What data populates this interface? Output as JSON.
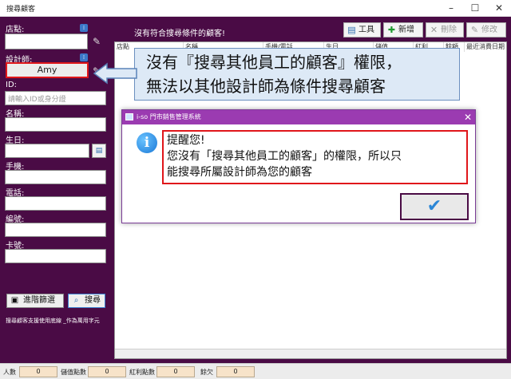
{
  "window": {
    "title": "搜尋顧客",
    "min": "–",
    "max": "☐",
    "close": "✕"
  },
  "sidebar": {
    "store_label": "店點:",
    "designer_label": "設計師:",
    "designer_value": "Amy",
    "id_label": "ID:",
    "id_placeholder": "請輸入ID或身分證",
    "name_label": "名稱:",
    "birthday_label": "生日:",
    "mobile_label": "手機:",
    "phone_label": "電話:",
    "number_label": "編號:",
    "card_label": "卡號:",
    "advanced_button": "進階篩選",
    "search_button": "搜尋",
    "note": "搜尋顧客支援使用底線 _作為萬用字元"
  },
  "main": {
    "no_result": "沒有符合搜尋條件的顧客!",
    "toolbar": {
      "tools": "工具",
      "add": "新增",
      "delete": "刪除",
      "edit": "修改"
    },
    "columns": [
      "店點",
      "名稱",
      "手機/電話",
      "生日",
      "儲值",
      "紅利",
      "餘額",
      "最近消費日期"
    ]
  },
  "callout": {
    "line1": "沒有『搜尋其他員工的顧客』權限，",
    "line2": "無法以其他設計師為條件搜尋顧客"
  },
  "dialog": {
    "title": "i-so 門市銷售管理系統",
    "heading": "提醒您!",
    "line1": "您沒有「搜尋其他員工的顧客」的權限，所以只",
    "line2": "能搜尋所屬設計師為您的顧客",
    "ok_icon": "checkmark-icon",
    "close": "✕"
  },
  "status": {
    "count_label": "人數",
    "count": "0",
    "stored_label": "儲值點數",
    "stored": "0",
    "bonus_label": "紅利點數",
    "bonus": "0",
    "balance_label": "餘欠",
    "balance": "0"
  },
  "colors": {
    "sidebar": "#4a0b45",
    "dialog_title": "#9b3bb1",
    "highlight": "#e0161a",
    "callout": "#dde9f6"
  }
}
